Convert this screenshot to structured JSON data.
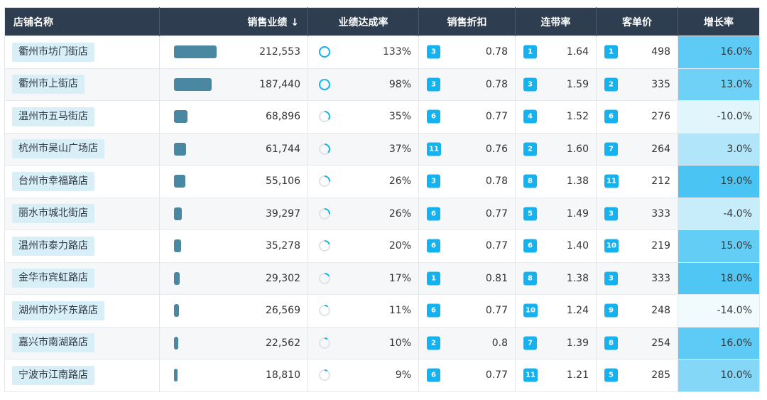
{
  "headers": {
    "store": "店铺名称",
    "sales": "销售业绩 ↓",
    "achievement": "业绩达成率",
    "discount": "销售折扣",
    "attach": "连带率",
    "unit_price": "客单价",
    "growth": "增长率"
  },
  "colors": {
    "header_bg": "#2e3e50",
    "bar": "#4a87a0",
    "ring": "#14b3f0",
    "badge": "#14b3f0",
    "tag_bg": "#d9eff8"
  },
  "rows": [
    {
      "store": "衢州市坊门街店",
      "sales": "212,553",
      "sales_value": 212553,
      "rate": "133%",
      "rate_value": 1.33,
      "disc_rank": "3",
      "discount": "0.78",
      "attach_rank": "1",
      "attach": "1.64",
      "price_rank": "1",
      "price": "498",
      "growth": "16.0%",
      "growth_value": 16.0
    },
    {
      "store": "衢州市上街店",
      "sales": "187,440",
      "sales_value": 187440,
      "rate": "98%",
      "rate_value": 0.98,
      "disc_rank": "3",
      "discount": "0.78",
      "attach_rank": "3",
      "attach": "1.59",
      "price_rank": "2",
      "price": "335",
      "growth": "13.0%",
      "growth_value": 13.0
    },
    {
      "store": "温州市五马街店",
      "sales": "68,896",
      "sales_value": 68896,
      "rate": "35%",
      "rate_value": 0.35,
      "disc_rank": "6",
      "discount": "0.77",
      "attach_rank": "4",
      "attach": "1.52",
      "price_rank": "6",
      "price": "276",
      "growth": "-10.0%",
      "growth_value": -10.0
    },
    {
      "store": "杭州市吴山广场店",
      "sales": "61,744",
      "sales_value": 61744,
      "rate": "37%",
      "rate_value": 0.37,
      "disc_rank": "11",
      "discount": "0.76",
      "attach_rank": "2",
      "attach": "1.60",
      "price_rank": "7",
      "price": "264",
      "growth": "3.0%",
      "growth_value": 3.0
    },
    {
      "store": "台州市幸福路店",
      "sales": "55,106",
      "sales_value": 55106,
      "rate": "26%",
      "rate_value": 0.26,
      "disc_rank": "3",
      "discount": "0.78",
      "attach_rank": "8",
      "attach": "1.38",
      "price_rank": "11",
      "price": "212",
      "growth": "19.0%",
      "growth_value": 19.0
    },
    {
      "store": "丽水市城北街店",
      "sales": "39,297",
      "sales_value": 39297,
      "rate": "26%",
      "rate_value": 0.26,
      "disc_rank": "6",
      "discount": "0.77",
      "attach_rank": "5",
      "attach": "1.49",
      "price_rank": "3",
      "price": "333",
      "growth": "-4.0%",
      "growth_value": -4.0
    },
    {
      "store": "温州市泰力路店",
      "sales": "35,278",
      "sales_value": 35278,
      "rate": "20%",
      "rate_value": 0.2,
      "disc_rank": "6",
      "discount": "0.77",
      "attach_rank": "6",
      "attach": "1.40",
      "price_rank": "10",
      "price": "219",
      "growth": "15.0%",
      "growth_value": 15.0
    },
    {
      "store": "金华市宾虹路店",
      "sales": "29,302",
      "sales_value": 29302,
      "rate": "17%",
      "rate_value": 0.17,
      "disc_rank": "1",
      "discount": "0.81",
      "attach_rank": "8",
      "attach": "1.38",
      "price_rank": "3",
      "price": "333",
      "growth": "18.0%",
      "growth_value": 18.0
    },
    {
      "store": "湖州市外环东路店",
      "sales": "26,569",
      "sales_value": 26569,
      "rate": "11%",
      "rate_value": 0.11,
      "disc_rank": "6",
      "discount": "0.77",
      "attach_rank": "10",
      "attach": "1.24",
      "price_rank": "9",
      "price": "248",
      "growth": "-14.0%",
      "growth_value": -14.0
    },
    {
      "store": "嘉兴市南湖路店",
      "sales": "22,562",
      "sales_value": 22562,
      "rate": "10%",
      "rate_value": 0.1,
      "disc_rank": "2",
      "discount": "0.8",
      "attach_rank": "7",
      "attach": "1.39",
      "price_rank": "8",
      "price": "254",
      "growth": "16.0%",
      "growth_value": 16.0
    },
    {
      "store": "宁波市江南路店",
      "sales": "18,810",
      "sales_value": 18810,
      "rate": "9%",
      "rate_value": 0.09,
      "disc_rank": "6",
      "discount": "0.77",
      "attach_rank": "11",
      "attach": "1.21",
      "price_rank": "5",
      "price": "285",
      "growth": "10.0%",
      "growth_value": 10.0
    }
  ]
}
